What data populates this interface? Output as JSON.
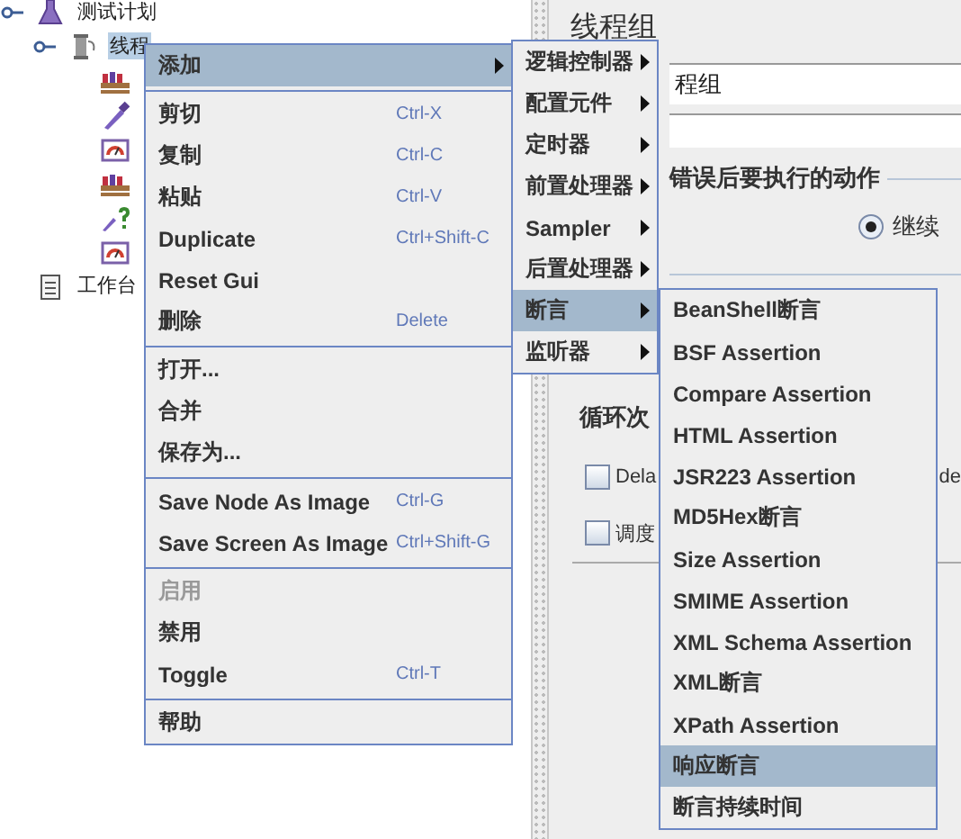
{
  "tree": [
    {
      "label": "测试计划",
      "expanded": true,
      "kind": "plan",
      "selected": false,
      "children": [
        {
          "label": "线程",
          "expanded": true,
          "kind": "thread-group",
          "selected": true,
          "children": [
            {
              "kind": "sampler",
              "selected": false
            },
            {
              "kind": "dropper",
              "selected": false
            },
            {
              "kind": "gauge",
              "selected": false
            },
            {
              "kind": "sampler",
              "selected": false
            },
            {
              "kind": "dropper-question",
              "selected": false
            },
            {
              "kind": "gauge",
              "selected": false
            }
          ]
        }
      ]
    },
    {
      "label": "工作台",
      "kind": "workbench",
      "selected": false
    }
  ],
  "panel": {
    "title": "线程组",
    "name_value": "程组",
    "error_action_label": "错误后要执行的动作",
    "radio": {
      "label": "继续",
      "selected": true
    },
    "loop_label": "循环次",
    "checkboxes": [
      {
        "label": "Dela",
        "checked": false,
        "tail": "de"
      },
      {
        "label": "调度",
        "checked": false
      }
    ]
  },
  "context_menu": {
    "groups": [
      [
        {
          "label": "添加",
          "kind": "submenu",
          "selected": true,
          "disabled": false
        }
      ],
      [
        {
          "label": "剪切",
          "shortcut": "Ctrl-X",
          "kind": "command",
          "selected": false,
          "disabled": false
        },
        {
          "label": "复制",
          "shortcut": "Ctrl-C",
          "kind": "command",
          "selected": false,
          "disabled": false
        },
        {
          "label": "粘贴",
          "shortcut": "Ctrl-V",
          "kind": "command",
          "selected": false,
          "disabled": false
        },
        {
          "label": "Duplicate",
          "shortcut": "Ctrl+Shift-C",
          "kind": "command",
          "selected": false,
          "disabled": false
        },
        {
          "label": "Reset Gui",
          "kind": "command",
          "selected": false,
          "disabled": false
        },
        {
          "label": "删除",
          "shortcut": "Delete",
          "kind": "command",
          "selected": false,
          "disabled": false
        }
      ],
      [
        {
          "label": "打开...",
          "kind": "command",
          "selected": false,
          "disabled": false
        },
        {
          "label": "合并",
          "kind": "command",
          "selected": false,
          "disabled": false
        },
        {
          "label": "保存为...",
          "kind": "command",
          "selected": false,
          "disabled": false
        }
      ],
      [
        {
          "label": "Save Node As Image",
          "shortcut": "Ctrl-G",
          "kind": "command",
          "selected": false,
          "disabled": false
        },
        {
          "label": "Save Screen As Image",
          "shortcut": "Ctrl+Shift-G",
          "kind": "command",
          "selected": false,
          "disabled": false
        }
      ],
      [
        {
          "label": "启用",
          "kind": "command",
          "selected": false,
          "disabled": true
        },
        {
          "label": "禁用",
          "kind": "command",
          "selected": false,
          "disabled": false
        },
        {
          "label": "Toggle",
          "shortcut": "Ctrl-T",
          "kind": "command",
          "selected": false,
          "disabled": false
        }
      ],
      [
        {
          "label": "帮助",
          "kind": "command",
          "selected": false,
          "disabled": false
        }
      ]
    ]
  },
  "add_submenu": [
    {
      "label": "逻辑控制器",
      "selected": false
    },
    {
      "label": "配置元件",
      "selected": false
    },
    {
      "label": "定时器",
      "selected": false
    },
    {
      "label": "前置处理器",
      "selected": false
    },
    {
      "label": "Sampler",
      "selected": false
    },
    {
      "label": "后置处理器",
      "selected": false
    },
    {
      "label": "断言",
      "selected": true
    },
    {
      "label": "监听器",
      "selected": false
    }
  ],
  "assertion_submenu": [
    {
      "label": "BeanShell断言",
      "selected": false
    },
    {
      "label": "BSF Assertion",
      "selected": false
    },
    {
      "label": "Compare Assertion",
      "selected": false
    },
    {
      "label": "HTML Assertion",
      "selected": false
    },
    {
      "label": "JSR223 Assertion",
      "selected": false
    },
    {
      "label": "MD5Hex断言",
      "selected": false
    },
    {
      "label": "Size Assertion",
      "selected": false
    },
    {
      "label": "SMIME Assertion",
      "selected": false
    },
    {
      "label": "XML Schema Assertion",
      "selected": false
    },
    {
      "label": "XML断言",
      "selected": false
    },
    {
      "label": "XPath Assertion",
      "selected": false
    },
    {
      "label": "响应断言",
      "selected": true
    },
    {
      "label": "断言持续时间",
      "selected": false
    }
  ]
}
